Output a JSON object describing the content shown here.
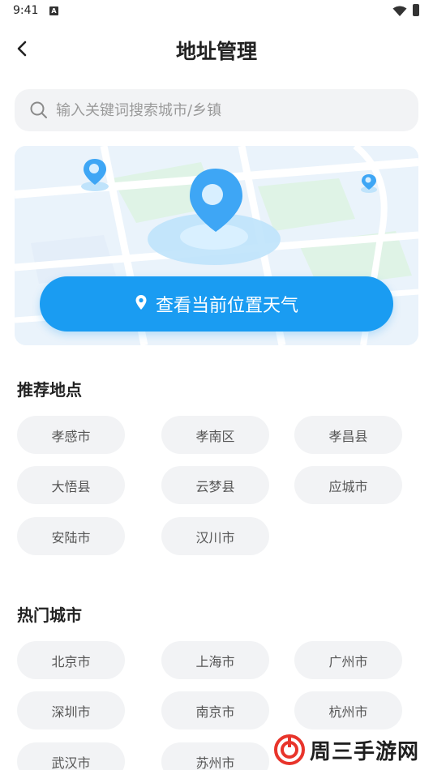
{
  "status_bar": {
    "time": "9:41",
    "notification_badge": "A"
  },
  "header": {
    "title": "地址管理"
  },
  "search": {
    "placeholder": "输入关键词搜索城市/乡镇",
    "value": ""
  },
  "map_card": {
    "locate_button_label": "查看当前位置天气",
    "accent_color": "#1a9cf2"
  },
  "recommended": {
    "title": "推荐地点",
    "items": [
      "孝感市",
      "孝南区",
      "孝昌县",
      "大悟县",
      "云梦县",
      "应城市",
      "安陆市",
      "汉川市"
    ]
  },
  "hot_cities": {
    "title": "热门城市",
    "items": [
      "北京市",
      "上海市",
      "广州市",
      "深圳市",
      "南京市",
      "杭州市",
      "武汉市",
      "苏州市"
    ]
  },
  "watermark": {
    "text": "周三手游网"
  },
  "icons": [
    "back-icon",
    "search-icon",
    "location-pin-icon",
    "wifi-icon",
    "battery-icon"
  ]
}
